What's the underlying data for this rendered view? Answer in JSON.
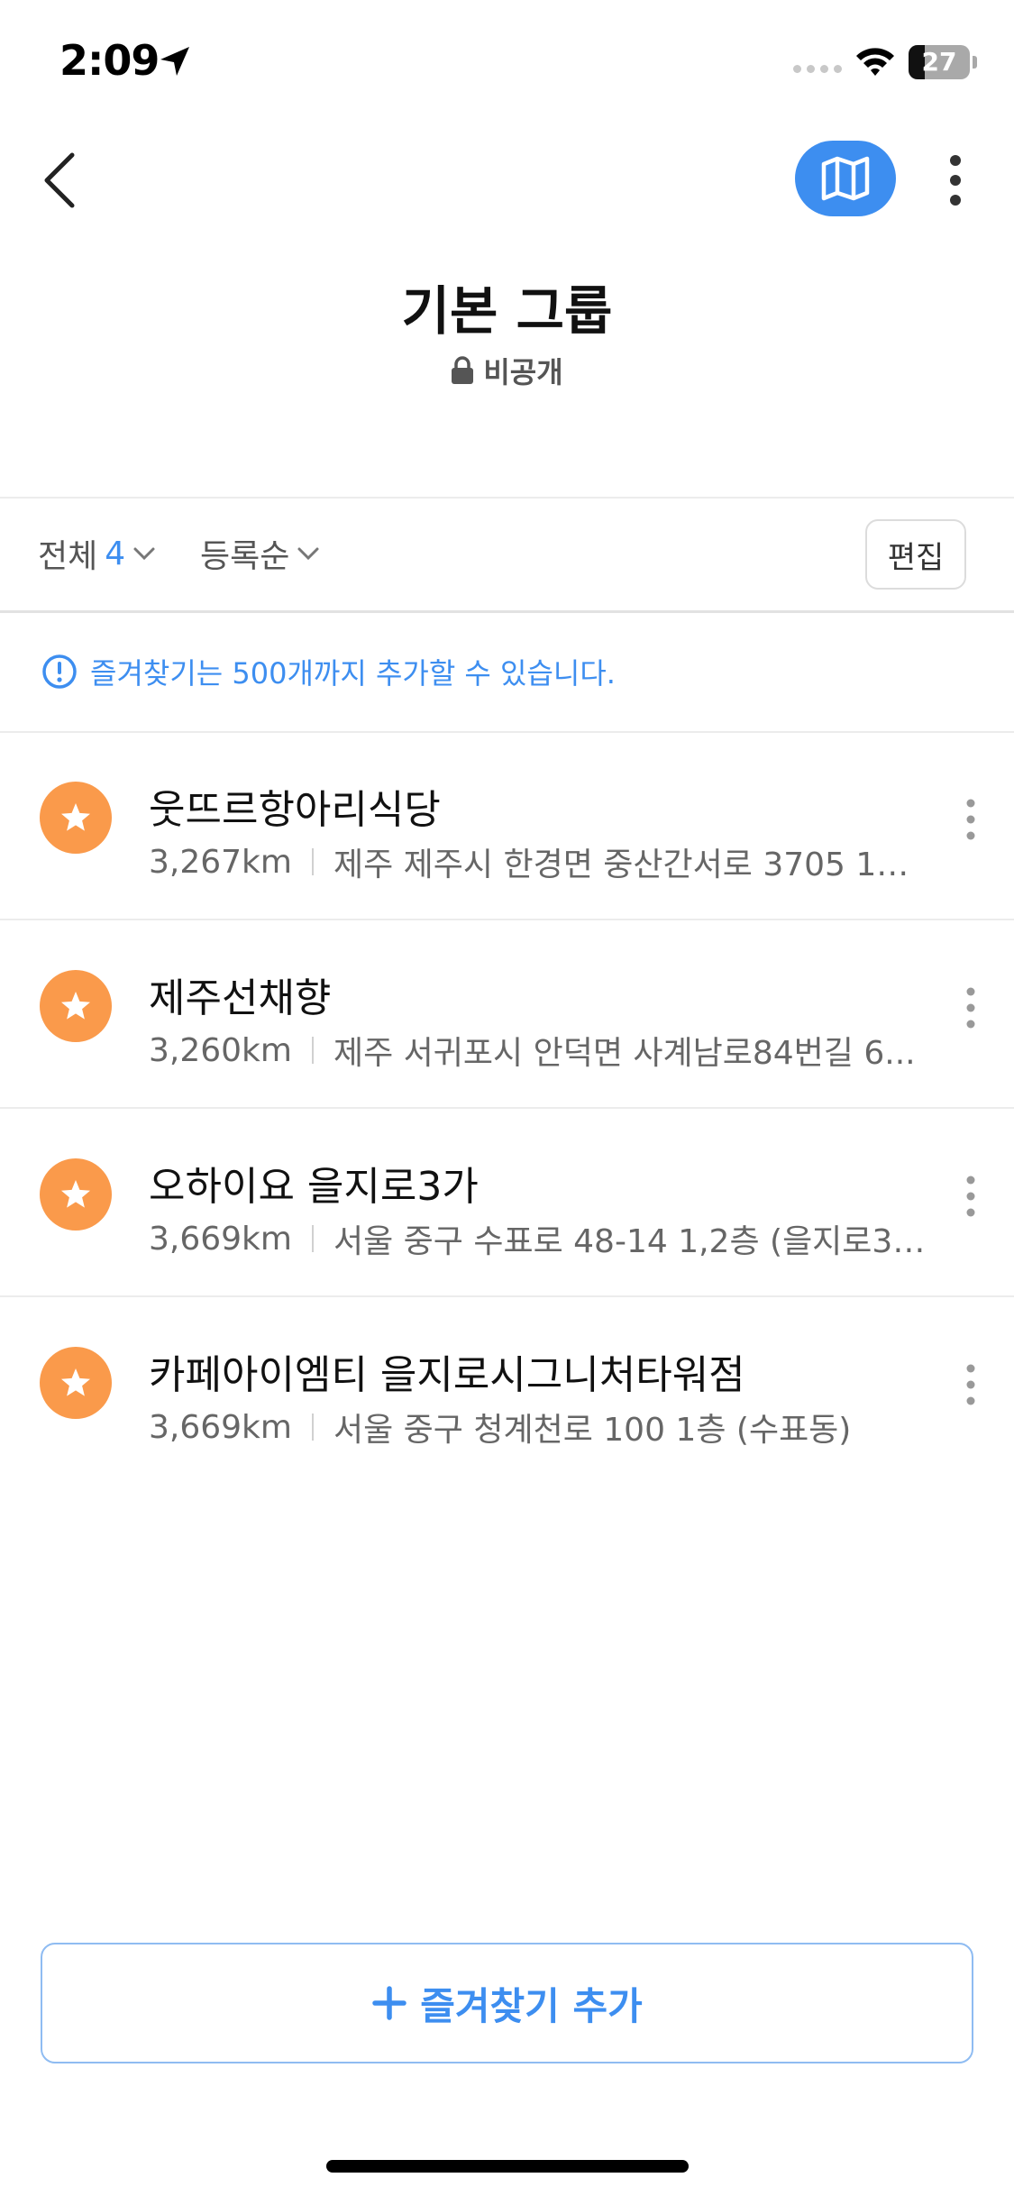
{
  "status_bar": {
    "time": "2:09",
    "battery": "27",
    "battery_level": 0.27
  },
  "header": {
    "title": "기본 그룹",
    "privacy": "비공개"
  },
  "filter": {
    "all_label": "전체",
    "count": "4",
    "sort_label": "등록순",
    "edit_label": "편집"
  },
  "notice": {
    "text": "즐겨찾기는 500개까지 추가할 수 있습니다."
  },
  "places": [
    {
      "name": "웃뜨르항아리식당",
      "distance": "3,267km",
      "address": "제주 제주시 한경면 중산간서로 3705 1…"
    },
    {
      "name": "제주선채향",
      "distance": "3,260km",
      "address": "제주 서귀포시 안덕면 사계남로84번길 6..."
    },
    {
      "name": "오하이요 을지로3가",
      "distance": "3,669km",
      "address": "서울 중구 수표로 48-14 1,2층 (을지로3…"
    },
    {
      "name": "카페아이엠티 을지로시그니처타워점",
      "distance": "3,669km",
      "address": "서울 중구 청계천로 100 1층 (수표동)"
    }
  ],
  "add_button": {
    "label": "즐겨찾기 추가"
  },
  "colors": {
    "accent": "#3d8ef0",
    "star_badge": "#fa9a4b"
  },
  "icons": [
    "location-arrow-icon",
    "wifi-icon",
    "battery-icon",
    "back-chevron-icon",
    "map-icon",
    "more-vertical-icon",
    "lock-icon",
    "chevron-down-icon",
    "info-icon",
    "star-icon",
    "plus-icon"
  ]
}
